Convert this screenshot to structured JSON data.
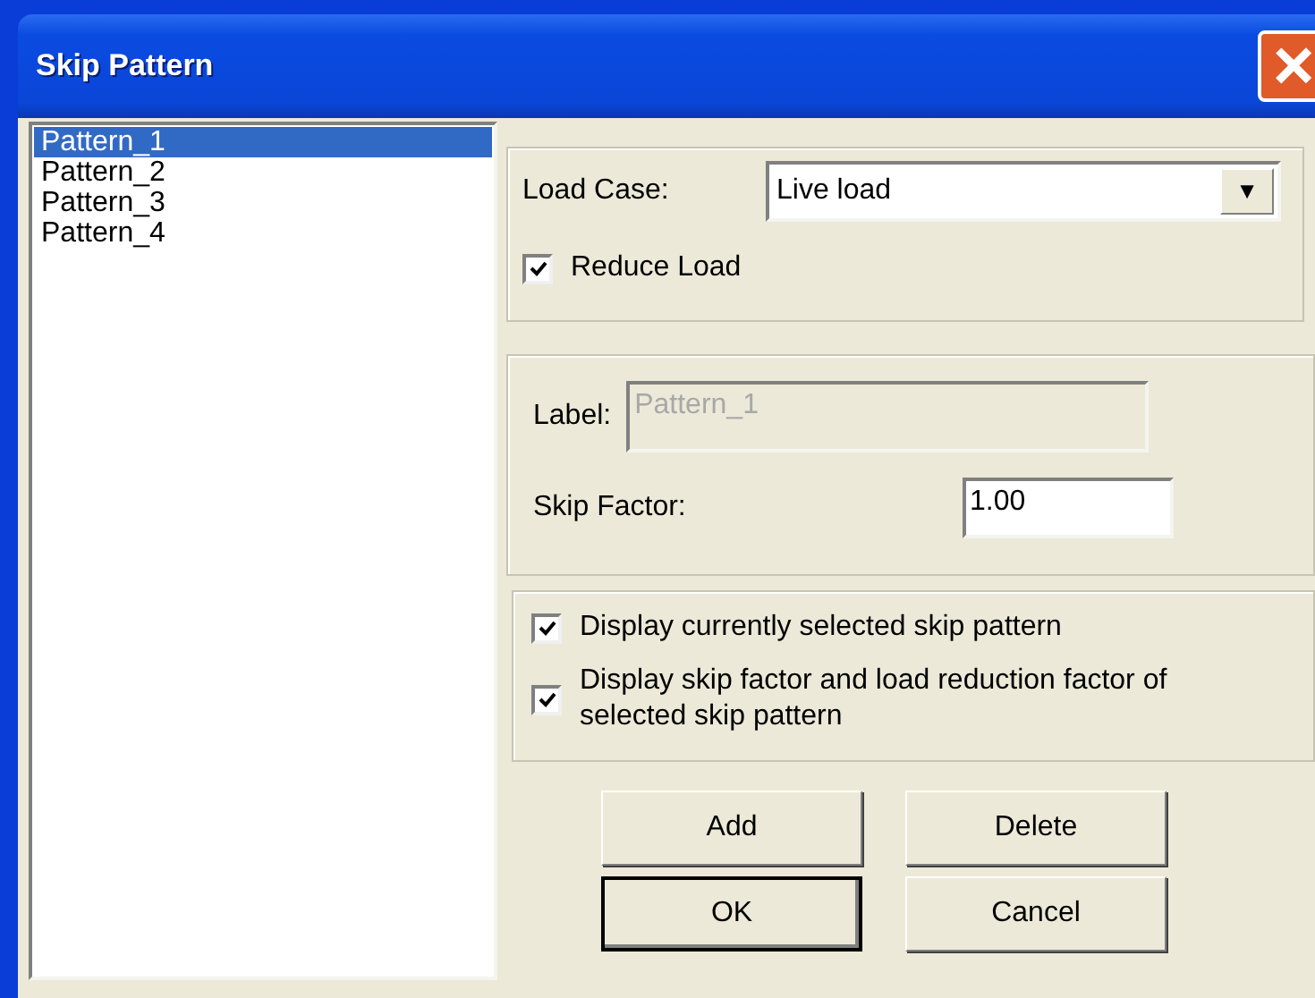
{
  "window": {
    "title": "Skip Pattern",
    "close": "×"
  },
  "patterns": [
    {
      "label": "Pattern_1",
      "selected": true
    },
    {
      "label": "Pattern_2",
      "selected": false
    },
    {
      "label": "Pattern_3",
      "selected": false
    },
    {
      "label": "Pattern_4",
      "selected": false
    }
  ],
  "load_case": {
    "label": "Load Case:",
    "value": "Live load",
    "caret": "▼"
  },
  "reduce_load": {
    "label": "Reduce Load",
    "checked": true
  },
  "label_field": {
    "label": "Label:",
    "value": "Pattern_1",
    "disabled": true
  },
  "skip_factor": {
    "label": "Skip Factor:",
    "value": "1.00"
  },
  "display_options": [
    {
      "label": "Display currently selected skip pattern",
      "checked": true
    },
    {
      "label": "Display skip factor and load reduction factor of selected skip pattern",
      "checked": true
    }
  ],
  "buttons": [
    {
      "label": "Add",
      "default": false
    },
    {
      "label": "Delete",
      "default": false
    },
    {
      "label": "OK",
      "default": true
    },
    {
      "label": "Cancel",
      "default": false
    }
  ]
}
